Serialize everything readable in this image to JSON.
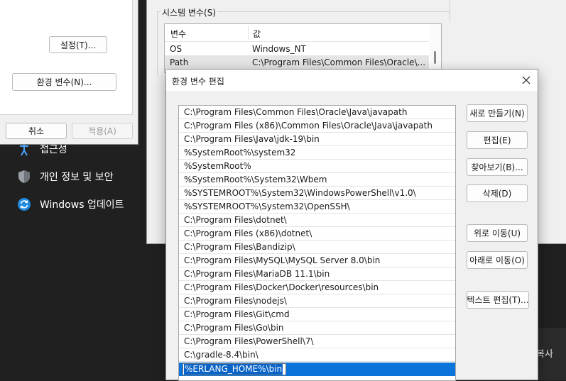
{
  "settings": {
    "items": [
      {
        "label": "접근성",
        "icon": "person-icon"
      },
      {
        "label": "개인 정보 및 보안",
        "icon": "shield-icon"
      },
      {
        "label": "Windows 업데이트",
        "icon": "update-icon"
      }
    ],
    "partial_right_text": "복사"
  },
  "left_dialog": {
    "settings_button": "설정(T)...",
    "env_vars_button": "환경 변수(N)...",
    "cancel_button": "취소",
    "apply_button": "적용(A)"
  },
  "system_vars": {
    "group_title": "시스템 변수(S)",
    "columns": [
      "변수",
      "값"
    ],
    "rows": [
      {
        "name": "OS",
        "value": "Windows_NT"
      },
      {
        "name": "Path",
        "value": "C:\\Program Files\\Common Files\\Oracle\\..."
      }
    ]
  },
  "edit_dialog": {
    "title": "환경 변수 편집",
    "paths": [
      "C:\\Program Files\\Common Files\\Oracle\\Java\\javapath",
      "C:\\Program Files (x86)\\Common Files\\Oracle\\Java\\javapath",
      "C:\\Program Files\\Java\\jdk-19\\bin",
      "%SystemRoot%\\system32",
      "%SystemRoot%",
      "%SystemRoot%\\System32\\Wbem",
      "%SYSTEMROOT%\\System32\\WindowsPowerShell\\v1.0\\",
      "%SYSTEMROOT%\\System32\\OpenSSH\\",
      "C:\\Program Files\\dotnet\\",
      "C:\\Program Files (x86)\\dotnet\\",
      "C:\\Program Files\\Bandizip\\",
      "C:\\Program Files\\MySQL\\MySQL Server 8.0\\bin",
      "C:\\Program Files\\MariaDB 11.1\\bin",
      "C:\\Program Files\\Docker\\Docker\\resources\\bin",
      "C:\\Program Files\\nodejs\\",
      "C:\\Program Files\\Git\\cmd",
      "C:\\Program Files\\Go\\bin",
      "C:\\Program Files\\PowerShell\\7\\",
      "C:\\gradle-8.4\\bin\\"
    ],
    "editing_value": "%ERLANG_HOME%\\bin",
    "buttons": {
      "new": "새로 만들기(N)",
      "edit": "편집(E)",
      "browse": "찾아보기(B)...",
      "delete": "삭제(D)",
      "move_up": "위로 이동(U)",
      "move_down": "아래로 이동(O)",
      "edit_text": "텍스트 편집(T)..."
    }
  },
  "colors": {
    "selection": "#0a74da",
    "settings_bg": "#202020",
    "dialog_bg": "#f0f0f0"
  }
}
